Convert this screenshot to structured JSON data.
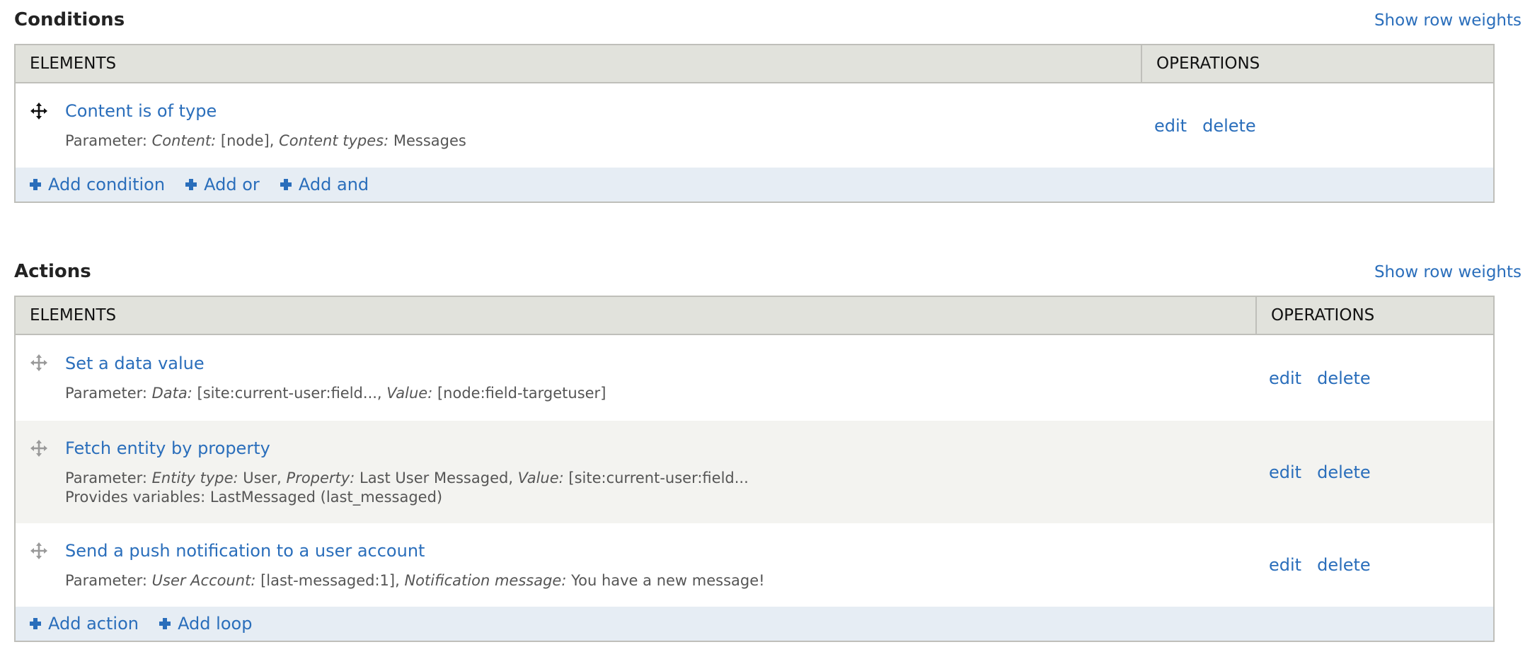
{
  "conditions": {
    "title": "Conditions",
    "row_weights_link": "Show row weights",
    "columns": [
      "ELEMENTS",
      "OPERATIONS"
    ],
    "rows": [
      {
        "label": "Content is of type",
        "icon": "drag-handle-icon",
        "description": {
          "prefix": "Parameter: ",
          "parts": [
            {
              "key": "Content:",
              "value": " [node], "
            },
            {
              "key": "Content types:",
              "value": " Messages"
            }
          ]
        },
        "operations": [
          "edit",
          "delete"
        ]
      }
    ],
    "add_links": [
      {
        "icon": "plus-icon",
        "label": "Add condition"
      },
      {
        "icon": "plus-icon",
        "label": "Add or"
      },
      {
        "icon": "plus-icon",
        "label": "Add and"
      }
    ]
  },
  "actions": {
    "title": "Actions",
    "row_weights_link": "Show row weights",
    "columns": [
      "ELEMENTS",
      "OPERATIONS"
    ],
    "rows": [
      {
        "label": "Set a data value",
        "icon": "drag-handle-icon",
        "description": {
          "prefix": "Parameter: ",
          "parts": [
            {
              "key": "Data:",
              "value": " [site:current-user:field..., "
            },
            {
              "key": "Value:",
              "value": " [node:field-targetuser]"
            }
          ]
        },
        "operations": [
          "edit",
          "delete"
        ]
      },
      {
        "label": "Fetch entity by property",
        "icon": "drag-handle-icon",
        "description": {
          "prefix": "Parameter: ",
          "parts": [
            {
              "key": "Entity type:",
              "value": " User, "
            },
            {
              "key": "Property:",
              "value": " Last User Messaged, "
            },
            {
              "key": "Value:",
              "value": " [site:current-user:field..."
            }
          ],
          "extra_line": "Provides variables: LastMessaged (last_messaged)"
        },
        "operations": [
          "edit",
          "delete"
        ]
      },
      {
        "label": "Send a push notification to a user account",
        "icon": "drag-handle-icon",
        "description": {
          "prefix": "Parameter: ",
          "parts": [
            {
              "key": "User Account:",
              "value": " [last-messaged:1], "
            },
            {
              "key": "Notification message:",
              "value": " You have a new message!"
            }
          ]
        },
        "operations": [
          "edit",
          "delete"
        ]
      }
    ],
    "add_links": [
      {
        "icon": "plus-icon",
        "label": "Add action"
      },
      {
        "icon": "plus-icon",
        "label": "Add loop"
      }
    ]
  },
  "colors": {
    "link": "#2a6ebb",
    "header_bg": "#e1e2dc",
    "alt_row_bg": "#f3f3f0",
    "add_row_bg": "#e6edf4",
    "border": "#bfbfba"
  }
}
